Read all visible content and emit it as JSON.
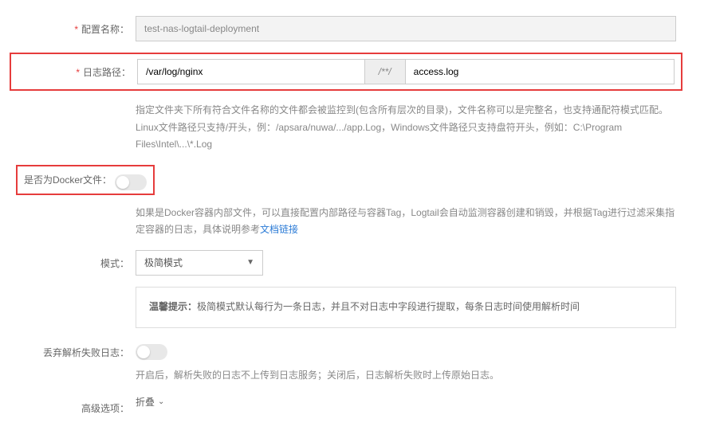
{
  "configName": {
    "label": "配置名称：",
    "value": "test-nas-logtail-deployment"
  },
  "logPath": {
    "label": "日志路径：",
    "dirValue": "/var/log/nginx",
    "separator": "/**/",
    "fileValue": "access.log",
    "help": "指定文件夹下所有符合文件名称的文件都会被监控到(包含所有层次的目录)，文件名称可以是完整名，也支持通配符模式匹配。Linux文件路径只支持/开头，例：/apsara/nuwa/.../app.Log，Windows文件路径只支持盘符开头，例如：C:\\Program Files\\Intel\\...\\*.Log"
  },
  "dockerFile": {
    "label": "是否为Docker文件：",
    "help_before_link": "如果是Docker容器内部文件，可以直接配置内部路径与容器Tag，Logtail会自动监测容器创建和销毁，并根据Tag进行过滤采集指定容器的日志，具体说明参考",
    "link_text": "文档链接"
  },
  "mode": {
    "label": "模式：",
    "value": "极简模式"
  },
  "tip": {
    "label": "温馨提示：",
    "text": "极简模式默认每行为一条日志，并且不对日志中字段进行提取，每条日志时间使用解析时间"
  },
  "discardFail": {
    "label": "丢弃解析失败日志：",
    "help": "开启后，解析失败的日志不上传到日志服务；关闭后，日志解析失败时上传原始日志。"
  },
  "advanced": {
    "label": "高级选项：",
    "value": "折叠"
  }
}
